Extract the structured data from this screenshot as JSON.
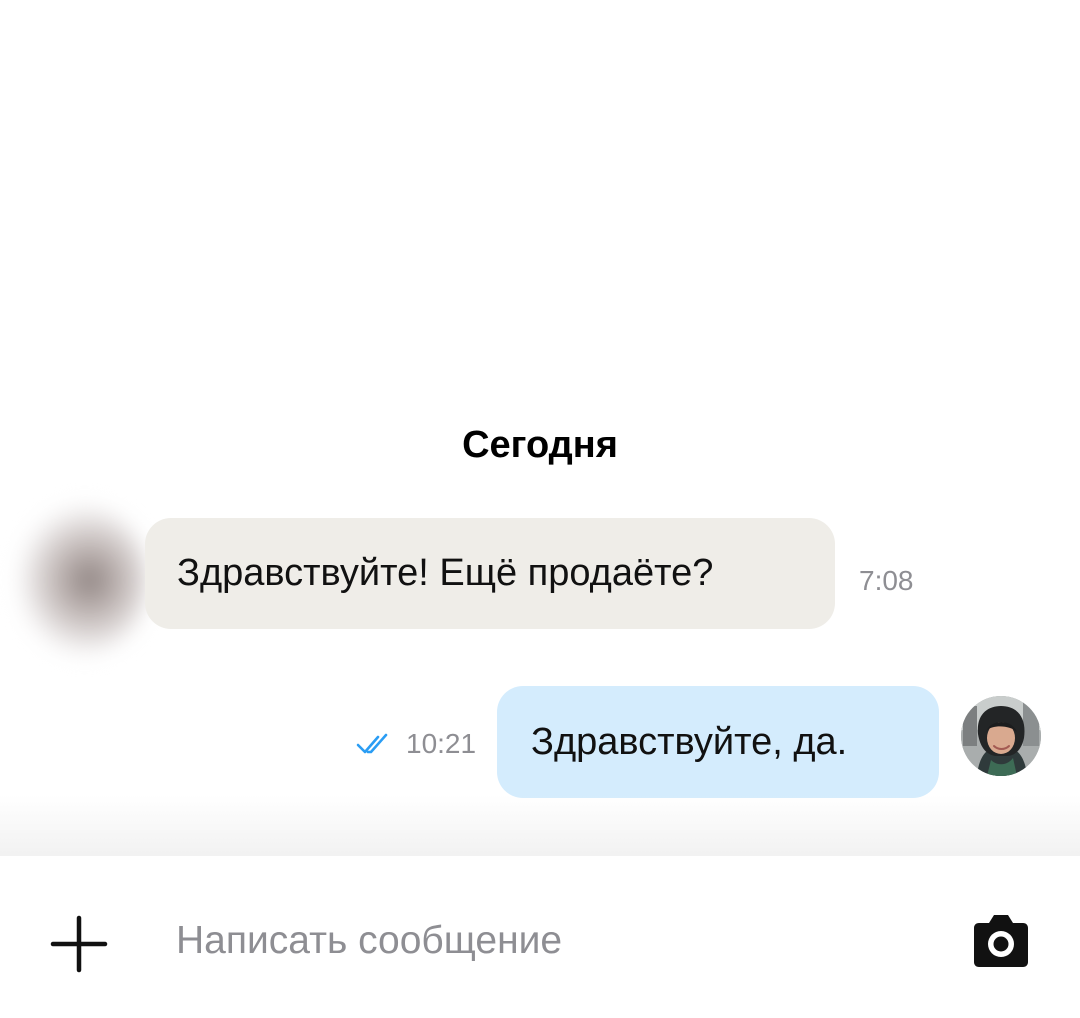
{
  "chat": {
    "date_divider": "Сегодня",
    "messages": [
      {
        "direction": "incoming",
        "text": "Здравствуйте! Ещё продаёте?",
        "time": "7:08",
        "bubble_color": "#efede8"
      },
      {
        "direction": "outgoing",
        "text": "Здравствуйте, да.",
        "time": "10:21",
        "status_icon": "double-check-icon",
        "status_color": "#2a9df4",
        "bubble_color": "#d4ecfd"
      }
    ]
  },
  "composer": {
    "add_icon": "plus-icon",
    "placeholder": "Написать сообщение",
    "value": "",
    "camera_icon": "camera-icon"
  }
}
